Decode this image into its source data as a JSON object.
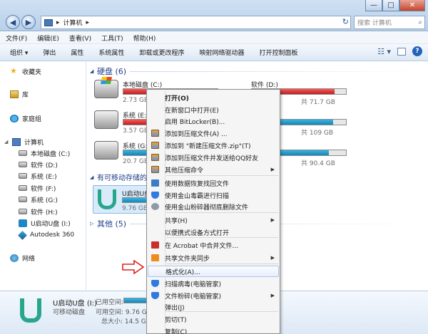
{
  "window": {
    "breadcrumb": "计算机",
    "search_placeholder": "搜索 计算机",
    "controls": {
      "minimize": "—",
      "maximize": "□",
      "close": "✕"
    }
  },
  "menubar": [
    "文件(F)",
    "编辑(E)",
    "查看(V)",
    "工具(T)",
    "帮助(H)"
  ],
  "toolbar": [
    "组织 ▾",
    "弹出",
    "属性",
    "系统属性",
    "卸载或更改程序",
    "映射网络驱动器",
    "打开控制面板"
  ],
  "nav": {
    "favorites": "收藏夹",
    "libraries": "库",
    "homegroup": "家庭组",
    "computer": "计算机",
    "drives": [
      "本地磁盘 (C:)",
      "软件 (D:)",
      "系统 (E:)",
      "软件 (F:)",
      "系统 (G:)",
      "软件 (H:)",
      "U启动U盘 (I:)",
      "Autodesk 360"
    ],
    "network": "网络"
  },
  "content": {
    "hdd_header": "硬盘 (6)",
    "removable_header": "有可移动存储的",
    "other_header": "其他 (5)",
    "drives": [
      {
        "name": "本地磁盘 (C:)",
        "free": "2.73 GB",
        "fill": 0.95,
        "color": "red"
      },
      {
        "name": "系统 (E:)",
        "free": "3.57 GB",
        "fill": 0.93,
        "color": "red"
      },
      {
        "name": "系统 (G:)",
        "free": "20.7 GB",
        "fill": 0.55,
        "color": "blue"
      },
      {
        "name": "软件 (D:)",
        "free": "共 71.7 GB",
        "fill": 0.88,
        "color": "red"
      },
      {
        "name": "",
        "free": "共 109 GB",
        "fill": 0.86,
        "color": "blue"
      },
      {
        "name": "",
        "free": "共 90.4 GB",
        "fill": 0.82,
        "color": "blue"
      }
    ],
    "usb": {
      "name": "U启动U盘",
      "free": "9.76 GB"
    }
  },
  "details": {
    "name": "U启动U盘 (I:)",
    "type": "可移动磁盘",
    "used_label": "已用空间:",
    "free_label": "可用空间: 9.76 GB",
    "total_label": "总大小: 14.5 GB"
  },
  "context_menu": {
    "items": [
      {
        "label": "打开(O)",
        "bold": true
      },
      {
        "label": "在新窗口中打开(E)"
      },
      {
        "label": "启用 BitLocker(B)..."
      },
      {
        "label": "添加到压缩文件(A) ...",
        "icon": "rar"
      },
      {
        "label": "添加到 \"新建压缩文件.zip\"(T)",
        "icon": "rar"
      },
      {
        "label": "添加到压缩文件并发送给QQ好友",
        "icon": "rar"
      },
      {
        "label": "其他压缩命令",
        "icon": "rar",
        "arrow": true
      },
      {
        "label": "使用数据恢复找回文件",
        "icon": "data"
      },
      {
        "label": "使用金山毒霸进行扫描",
        "icon": "shield"
      },
      {
        "label": "使用金山粉碎器彻底删除文件",
        "icon": "gray"
      },
      {
        "label": "共享(H)",
        "arrow": true
      },
      {
        "label": "以便携式设备方式打开"
      },
      {
        "label": "在 Acrobat 中合并文件...",
        "icon": "pdf"
      },
      {
        "label": "共享文件夹同步",
        "icon": "s",
        "arrow": true
      },
      {
        "label": "格式化(A)...",
        "highlight": true
      },
      {
        "label": "扫描病毒(电脑管家)",
        "icon": "shield"
      },
      {
        "label": "文件粉碎(电脑管家)",
        "icon": "shield",
        "arrow": true
      },
      {
        "label": "弹出(J)"
      },
      {
        "label": "剪切(T)"
      },
      {
        "label": "复制(C)"
      }
    ]
  },
  "colors": {
    "accent": "#1e3f8a",
    "annotation_arrow": "#e02020",
    "highlight_border": "#a8c5ea"
  }
}
